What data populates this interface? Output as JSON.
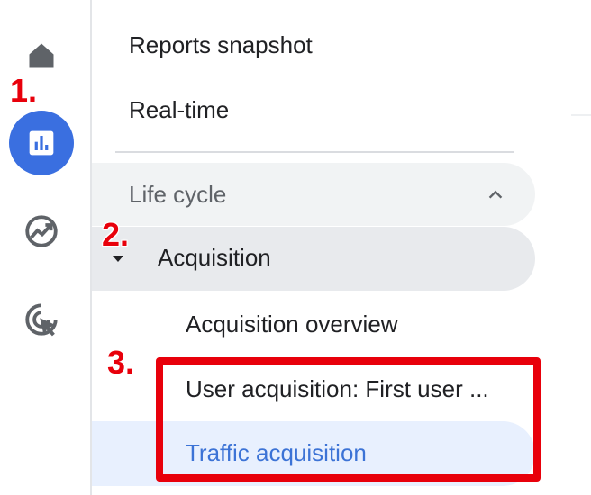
{
  "rail": {
    "icons": [
      "home-icon",
      "bar-chart-icon",
      "explore-icon",
      "advertising-icon"
    ]
  },
  "nav": {
    "reports_snapshot": "Reports snapshot",
    "realtime": "Real-time",
    "section": {
      "label": "Life cycle",
      "icon": "chevron-up-icon"
    },
    "group": {
      "label": "Acquisition",
      "icon": "caret-down-icon"
    },
    "items": [
      "Acquisition overview",
      "User acquisition: First user ...",
      "Traffic acquisition"
    ],
    "selected_item": "Traffic acquisition"
  },
  "annotations": {
    "step1": "1.",
    "step2": "2.",
    "step3": "3."
  },
  "colors": {
    "accent": "#3a6fe0",
    "selected_text": "#3c73d6",
    "selected_bg": "#e8f0fe",
    "annotation": "#e8000b"
  }
}
